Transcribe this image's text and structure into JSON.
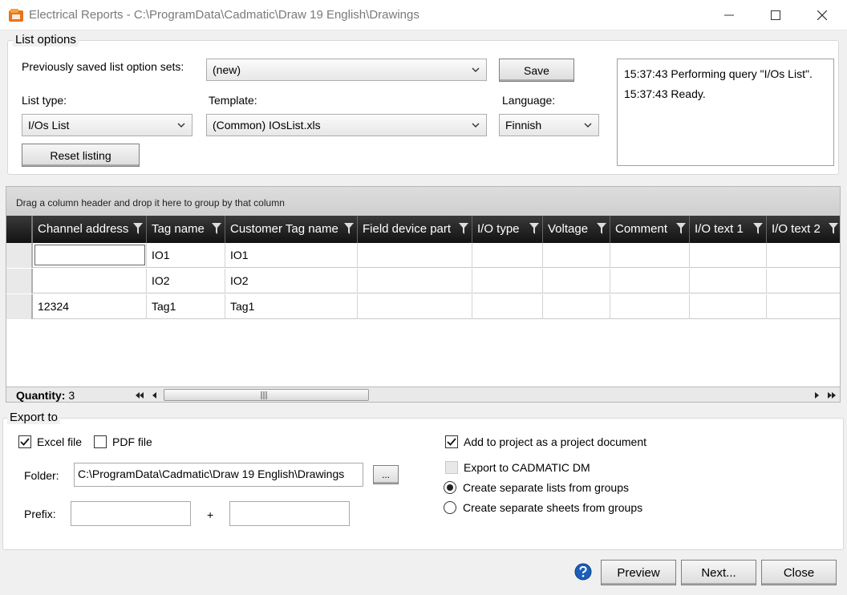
{
  "window": {
    "title": "Electrical Reports - C:\\ProgramData\\Cadmatic\\Draw 19 English\\Drawings",
    "minimize": "—",
    "maximize": "☐",
    "close": "✕"
  },
  "list_options": {
    "group_title": "List options",
    "saved_sets_label": "Previously saved list option sets:",
    "saved_sets_value": "(new)",
    "save_button": "Save",
    "list_type_label": "List type:",
    "list_type_value": "I/Os List",
    "template_label": "Template:",
    "template_value": "(Common) IOsList.xls",
    "language_label": "Language:",
    "language_value": "Finnish",
    "reset_button": "Reset listing",
    "log": [
      "15:37:43 Performing query \"I/Os List\".",
      "15:37:43 Ready."
    ]
  },
  "grid": {
    "group_hint": "Drag a column header and drop it here to group by that column",
    "columns": [
      "Channel address",
      "Tag name",
      "Customer Tag name",
      "Field device part",
      "I/O type",
      "Voltage",
      "Comment",
      "I/O text 1",
      "I/O text 2"
    ],
    "rows": [
      [
        "",
        "IO1",
        "IO1",
        "",
        "",
        "",
        "",
        "",
        ""
      ],
      [
        "",
        "IO2",
        "IO2",
        "",
        "",
        "",
        "",
        "",
        ""
      ],
      [
        "12324",
        "Tag1",
        "Tag1",
        "",
        "",
        "",
        "",
        "",
        ""
      ]
    ],
    "quantity_label": "Quantity:",
    "quantity_value": "3"
  },
  "export": {
    "group_title": "Export to",
    "excel_label": "Excel file",
    "excel_checked": true,
    "pdf_label": "PDF file",
    "pdf_checked": false,
    "folder_label": "Folder:",
    "folder_value": "C:\\ProgramData\\Cadmatic\\Draw 19 English\\Drawings",
    "browse_button": "...",
    "prefix_label": "Prefix:",
    "prefix_value": "",
    "plus": "+",
    "suffix_value": "",
    "add_to_project_label": "Add to project as a project document",
    "add_to_project_checked": true,
    "cadmatic_dm_label": "Export to CADMATIC DM",
    "separate_lists_label": "Create separate lists from groups",
    "separate_sheets_label": "Create separate sheets from groups",
    "selected_option": "separate_lists"
  },
  "actions": {
    "preview": "Preview",
    "next": "Next...",
    "close": "Close"
  },
  "colors": {
    "header_dark": "#1e1e1e",
    "help_blue": "#1b5fb8",
    "app_icon_orange": "#e8731a"
  }
}
